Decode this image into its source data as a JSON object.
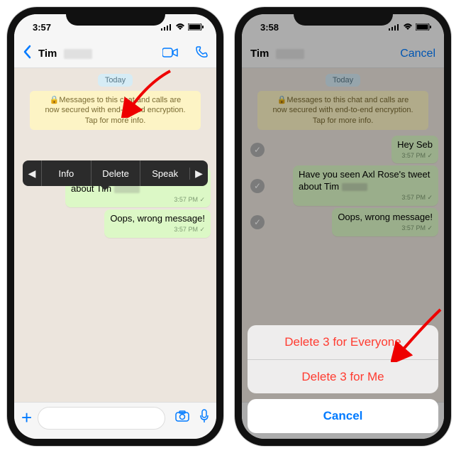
{
  "status": {
    "time_left": "3:57",
    "time_right": "3:58"
  },
  "header": {
    "contact_name": "Tim",
    "cancel": "Cancel"
  },
  "chat": {
    "date": "Today",
    "encryption": "🔒Messages to this chat and calls are now secured with end-to-end encryption. Tap for more info.",
    "messages": [
      {
        "text": "Hey Seb",
        "time": "3:57 PM"
      },
      {
        "text": "Have you seen Axl Rose's tweet about Tim",
        "time": "3:57 PM",
        "blur_after": true
      },
      {
        "text": "Oops, wrong message!",
        "time": "3:57 PM"
      }
    ]
  },
  "context_menu": {
    "info": "Info",
    "delete": "Delete",
    "speak": "Speak"
  },
  "sheet": {
    "delete_everyone": "Delete 3 for Everyone",
    "delete_me": "Delete 3 for Me",
    "cancel": "Cancel"
  }
}
